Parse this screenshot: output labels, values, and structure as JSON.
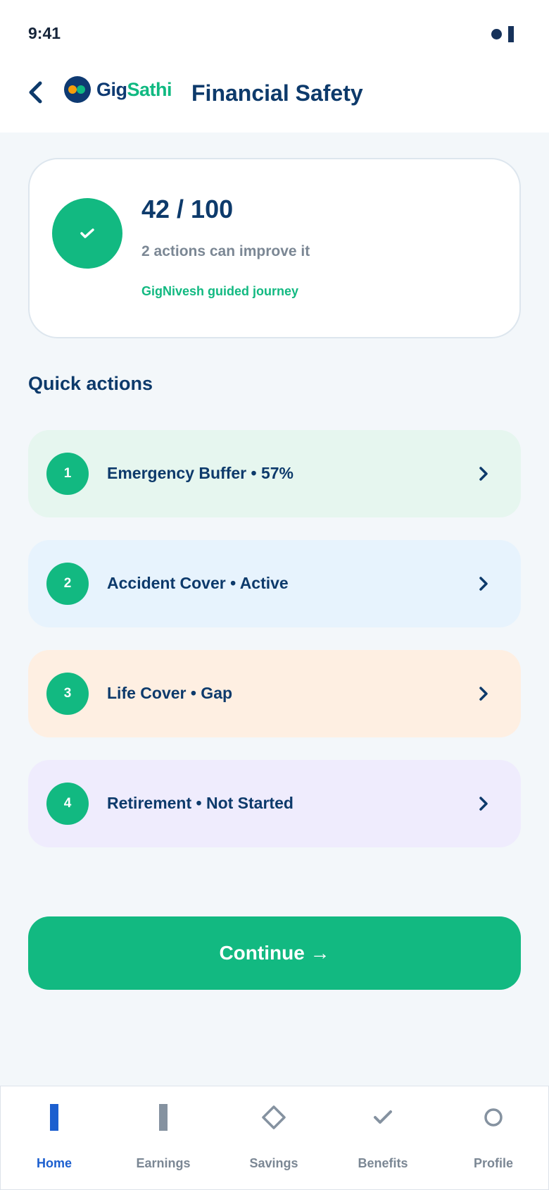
{
  "status_bar": {
    "time": "9:41"
  },
  "header": {
    "logo": {
      "part1": "Gig",
      "part2": "Sathi"
    },
    "title": "Financial Safety"
  },
  "score_card": {
    "score": "42 / 100",
    "subtitle": "2 actions can improve it",
    "link": "GigNivesh guided journey",
    "icon": "check-icon"
  },
  "quick_actions": {
    "title": "Quick actions",
    "items": [
      {
        "number": "1",
        "label": "Emergency Buffer • 57%",
        "bg": "#e6f6ef"
      },
      {
        "number": "2",
        "label": "Accident Cover • Active",
        "bg": "#e7f3fd"
      },
      {
        "number": "3",
        "label": "Life Cover • Gap",
        "bg": "#feefe2"
      },
      {
        "number": "4",
        "label": "Retirement • Not Started",
        "bg": "#efecfd"
      }
    ]
  },
  "continue_button": {
    "label": "Continue →"
  },
  "bottom_nav": {
    "items": [
      {
        "label": "Home",
        "icon": "home-icon",
        "active": true
      },
      {
        "label": "Earnings",
        "icon": "earnings-icon",
        "active": false
      },
      {
        "label": "Savings",
        "icon": "savings-icon",
        "active": false
      },
      {
        "label": "Benefits",
        "icon": "benefits-icon",
        "active": false
      },
      {
        "label": "Profile",
        "icon": "profile-icon",
        "active": false
      }
    ]
  },
  "colors": {
    "primary_green": "#12b981",
    "navy": "#0d3a6b",
    "active_blue": "#1c5fcf",
    "muted_gray": "#7b8794"
  }
}
